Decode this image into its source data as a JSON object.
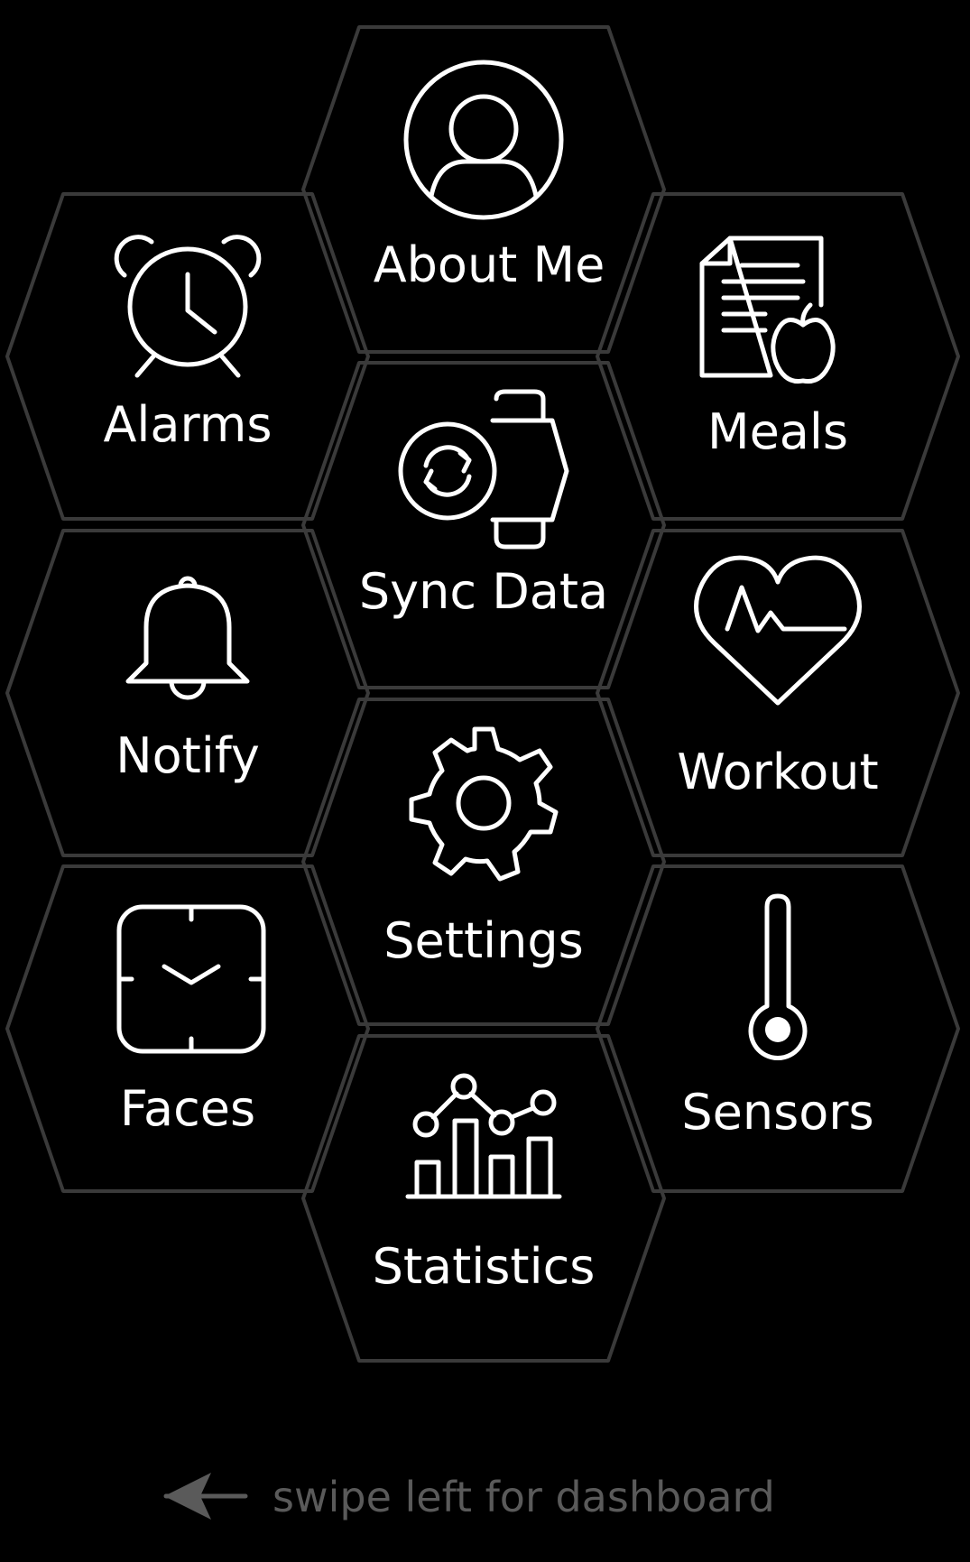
{
  "menu": {
    "about_me": {
      "label": "About Me",
      "icon": "person-icon"
    },
    "alarms": {
      "label": "Alarms",
      "icon": "alarm-clock-icon"
    },
    "meals": {
      "label": "Meals",
      "icon": "meal-document-icon"
    },
    "sync_data": {
      "label": "Sync Data",
      "icon": "sync-watch-icon"
    },
    "notify": {
      "label": "Notify",
      "icon": "bell-icon"
    },
    "workout": {
      "label": "Workout",
      "icon": "heart-pulse-icon"
    },
    "settings": {
      "label": "Settings",
      "icon": "gear-icon"
    },
    "faces": {
      "label": "Faces",
      "icon": "watch-face-icon"
    },
    "sensors": {
      "label": "Sensors",
      "icon": "thermometer-icon"
    },
    "statistics": {
      "label": "Statistics",
      "icon": "chart-icon"
    }
  },
  "hint": {
    "text": "swipe left for dashboard",
    "icon": "arrow-left-icon"
  },
  "colors": {
    "background": "#000000",
    "icon": "#ffffff",
    "hex_outline": "#3a3a3a",
    "hint": "#5a5a5a"
  }
}
